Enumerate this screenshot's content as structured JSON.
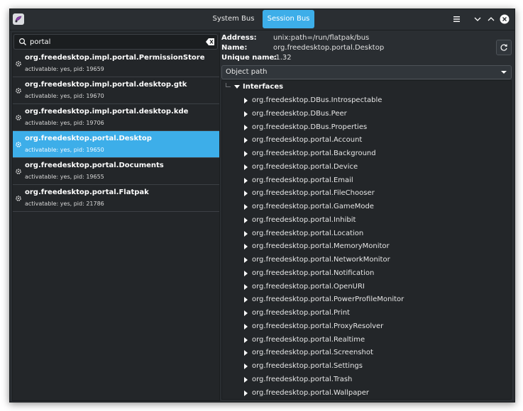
{
  "header": {
    "tabs": [
      {
        "label": "System Bus",
        "active": false
      },
      {
        "label": "Session Bus",
        "active": true
      }
    ],
    "accent_color": "#3daee9"
  },
  "search": {
    "value": "portal",
    "placeholder": ""
  },
  "services": [
    {
      "name": "org.freedesktop.impl.portal.PermissionStore",
      "desc": "activatable: yes, pid: 19659",
      "selected": false
    },
    {
      "name": "org.freedesktop.impl.portal.desktop.gtk",
      "desc": "activatable: yes, pid: 19670",
      "selected": false
    },
    {
      "name": "org.freedesktop.impl.portal.desktop.kde",
      "desc": "activatable: yes, pid: 19706",
      "selected": false
    },
    {
      "name": "org.freedesktop.portal.Desktop",
      "desc": "activatable: yes, pid: 19650",
      "selected": true
    },
    {
      "name": "org.freedesktop.portal.Documents",
      "desc": "activatable: yes, pid: 19655",
      "selected": false
    },
    {
      "name": "org.freedesktop.portal.Flatpak",
      "desc": "activatable: yes, pid: 21786",
      "selected": false
    }
  ],
  "details": {
    "address_label": "Address:",
    "address": "unix:path=/run/flatpak/bus",
    "name_label": "Name:",
    "name": "org.freedesktop.portal.Desktop",
    "unique_label": "Unique name:",
    "unique": ":1.32"
  },
  "view_combo": {
    "selected": "Object path"
  },
  "tree": {
    "root_label": "Interfaces",
    "interfaces": [
      "org.freedesktop.DBus.Introspectable",
      "org.freedesktop.DBus.Peer",
      "org.freedesktop.DBus.Properties",
      "org.freedesktop.portal.Account",
      "org.freedesktop.portal.Background",
      "org.freedesktop.portal.Device",
      "org.freedesktop.portal.Email",
      "org.freedesktop.portal.FileChooser",
      "org.freedesktop.portal.GameMode",
      "org.freedesktop.portal.Inhibit",
      "org.freedesktop.portal.Location",
      "org.freedesktop.portal.MemoryMonitor",
      "org.freedesktop.portal.NetworkMonitor",
      "org.freedesktop.portal.Notification",
      "org.freedesktop.portal.OpenURI",
      "org.freedesktop.portal.PowerProfileMonitor",
      "org.freedesktop.portal.Print",
      "org.freedesktop.portal.ProxyResolver",
      "org.freedesktop.portal.Realtime",
      "org.freedesktop.portal.Screenshot",
      "org.freedesktop.portal.Settings",
      "org.freedesktop.portal.Trash",
      "org.freedesktop.portal.Wallpaper"
    ]
  }
}
